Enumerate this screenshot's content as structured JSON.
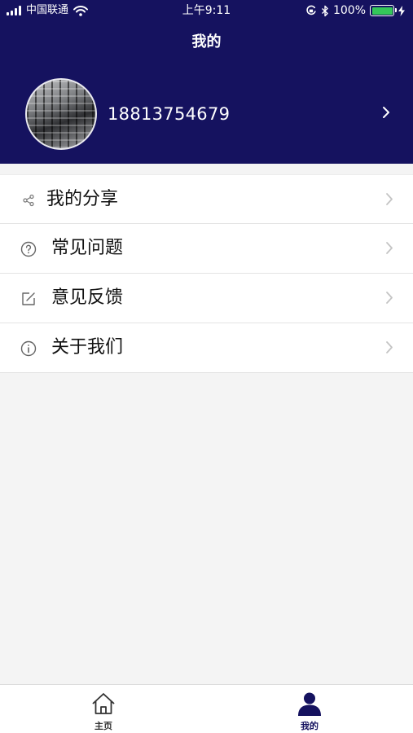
{
  "status_bar": {
    "carrier": "中国联通",
    "time": "上午9:11",
    "battery_text": "100%",
    "battery_level": 1.0,
    "battery_color": "#34c759"
  },
  "header": {
    "title": "我的",
    "background_color": "#15125f"
  },
  "profile": {
    "phone": "18813754679"
  },
  "menu": {
    "items": [
      {
        "icon": "share-icon",
        "label": "我的分享"
      },
      {
        "icon": "question-icon",
        "label": "常见问题"
      },
      {
        "icon": "edit-icon",
        "label": "意见反馈"
      },
      {
        "icon": "info-icon",
        "label": "关于我们"
      }
    ]
  },
  "tabbar": {
    "tabs": [
      {
        "icon": "home-icon",
        "label": "主页",
        "active": false
      },
      {
        "icon": "user-icon",
        "label": "我的",
        "active": true
      }
    ],
    "active_color": "#15125f",
    "inactive_color": "#333333"
  }
}
